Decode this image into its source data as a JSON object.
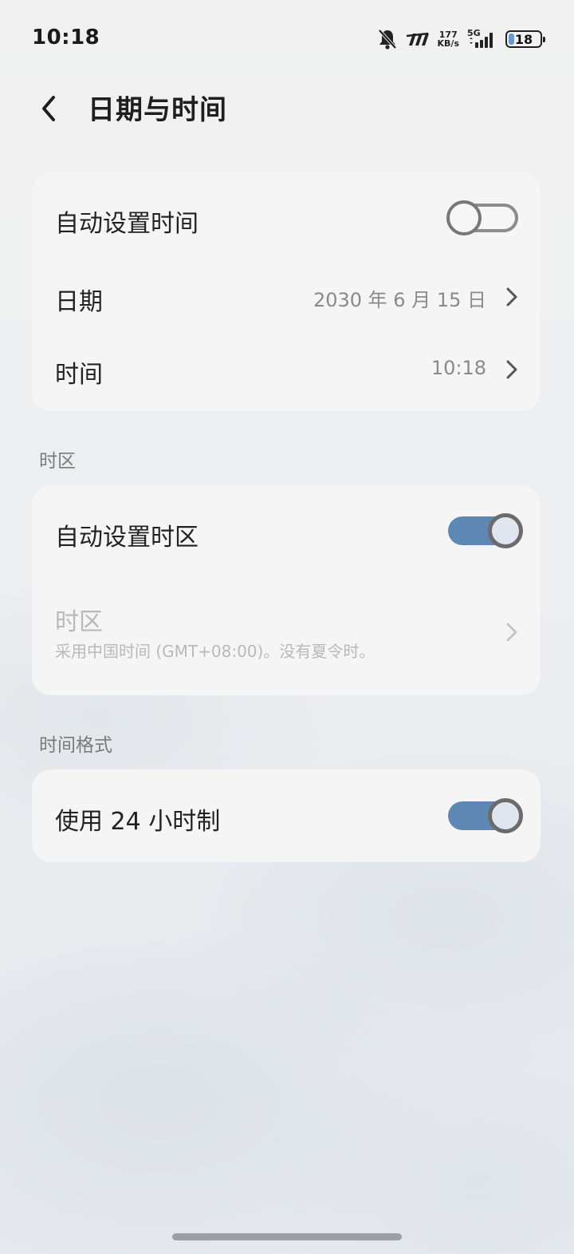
{
  "status_bar": {
    "time": "10:18",
    "net_speed_value": "177",
    "net_speed_unit": "KB/s",
    "network_type": "5G",
    "battery_level": "18",
    "icons": [
      "bell-muted-icon",
      "carrier-logo-icon",
      "signal-bars-icon",
      "battery-icon"
    ]
  },
  "header": {
    "title": "日期与时间"
  },
  "datetime_card": {
    "auto_time_label": "自动设置时间",
    "auto_time_enabled": false,
    "date_label": "日期",
    "date_value": "2030 年 6 月 15 日",
    "time_label": "时间",
    "time_value": "10:18"
  },
  "timezone_section": {
    "section_title": "时区",
    "auto_zone_label": "自动设置时区",
    "auto_zone_enabled": true,
    "zone_label": "时区",
    "zone_summary": "采用中国时间 (GMT+08:00)。没有夏令时。"
  },
  "format_section": {
    "section_title": "时间格式",
    "use_24h_label": "使用 24 小时制",
    "use_24h_enabled": true
  },
  "colors": {
    "toggle_on": "#5f87b4",
    "card_bg": "#f5f5f5",
    "disabled_text": "#b9b9b9"
  }
}
